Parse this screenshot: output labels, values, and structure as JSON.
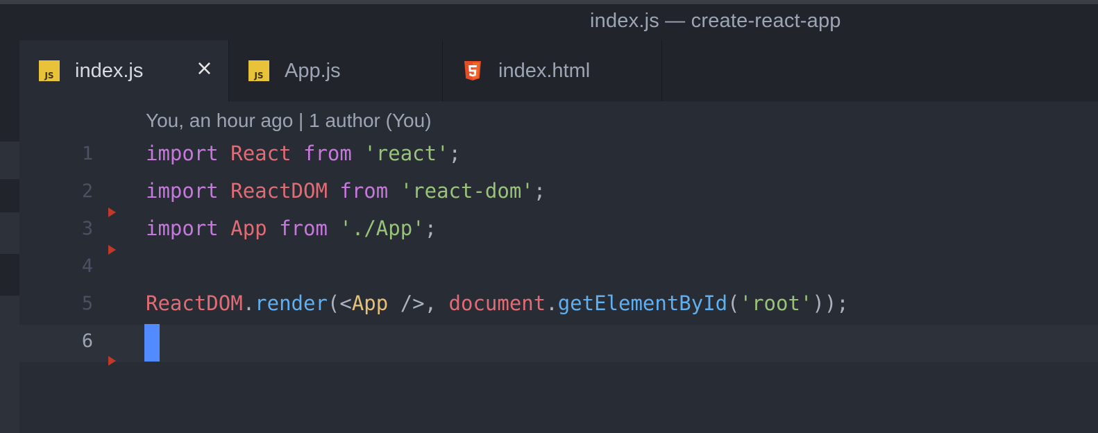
{
  "window": {
    "title": "index.js — create-react-app"
  },
  "tabs": [
    {
      "label": "index.js",
      "icon": "js-file-icon",
      "icon_text": "JS",
      "active": true,
      "close_glyph": "×"
    },
    {
      "label": "App.js",
      "icon": "js-file-icon",
      "icon_text": "JS",
      "active": false
    },
    {
      "label": "index.html",
      "icon": "html5-file-icon",
      "active": false
    }
  ],
  "editor": {
    "blame": "You, an hour ago | 1 author (You)",
    "lines": [
      {
        "number": "1",
        "text": "import React from 'react';"
      },
      {
        "number": "2",
        "text": "import ReactDOM from 'react-dom';"
      },
      {
        "number": "3",
        "text": "import App from './App';"
      },
      {
        "number": "4",
        "text": ""
      },
      {
        "number": "5",
        "text": "ReactDOM.render(<App />, document.getElementById('root'));"
      },
      {
        "number": "6",
        "text": ""
      }
    ],
    "tokens": {
      "import": "import",
      "from": "from",
      "react_ident": "React",
      "reactdom_ident": "ReactDOM",
      "app_ident": "App",
      "str_react": "'react'",
      "str_react_dom": "'react-dom'",
      "str_app": "'./App'",
      "semi": ";",
      "dot": ".",
      "render": "render",
      "paren_open_lt": "(<",
      "jsx_app": "App",
      "jsx_close": " />, ",
      "document": "document",
      "getElementById": "getElementById",
      "paren_open": "(",
      "str_root": "'root'",
      "close_all": "));"
    },
    "current_line": "6"
  },
  "colors": {
    "background": "#282c34",
    "keyword": "#c678dd",
    "variable": "#e06c75",
    "string": "#98c379",
    "function": "#61afef",
    "jsx_tag": "#e5c07b",
    "cursor": "#528bff",
    "js_icon": "#e8c238",
    "html_icon": "#e44d26",
    "git_marker": "#c0392b"
  }
}
